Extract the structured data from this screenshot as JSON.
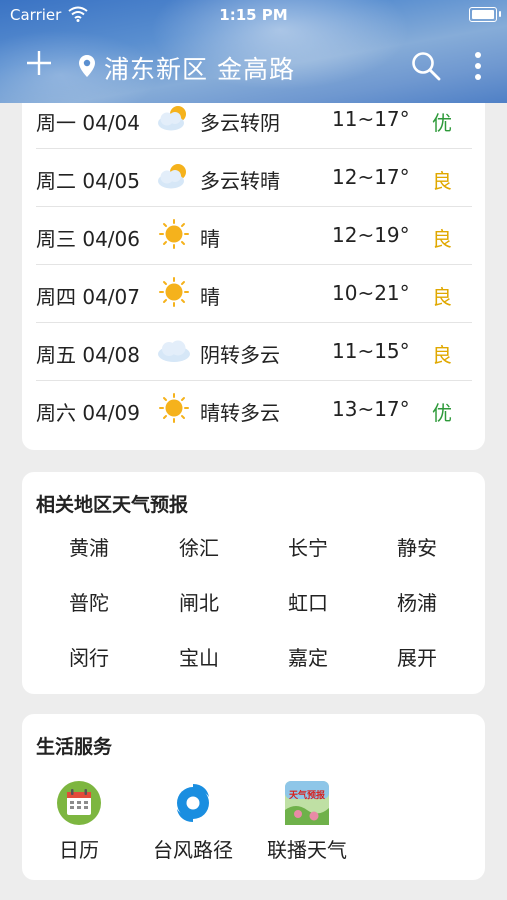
{
  "status": {
    "carrier": "Carrier",
    "time": "1:15 PM"
  },
  "header": {
    "location": "浦东新区 金高路"
  },
  "forecast": [
    {
      "date": "周一 04/04",
      "icon": "cloudy-sun-icon",
      "condition": "多云转阴",
      "temp": "11~17°",
      "aqi": "优",
      "aqi_color": "#2e9a3a"
    },
    {
      "date": "周二 04/05",
      "icon": "cloudy-sun-icon",
      "condition": "多云转晴",
      "temp": "12~17°",
      "aqi": "良",
      "aqi_color": "#e0a800"
    },
    {
      "date": "周三 04/06",
      "icon": "sun-icon",
      "condition": "晴",
      "temp": "12~19°",
      "aqi": "良",
      "aqi_color": "#e0a800"
    },
    {
      "date": "周四 04/07",
      "icon": "sun-icon",
      "condition": "晴",
      "temp": "10~21°",
      "aqi": "良",
      "aqi_color": "#e0a800"
    },
    {
      "date": "周五 04/08",
      "icon": "cloud-icon",
      "condition": "阴转多云",
      "temp": "11~15°",
      "aqi": "良",
      "aqi_color": "#e0a800"
    },
    {
      "date": "周六 04/09",
      "icon": "sun-icon",
      "condition": "晴转多云",
      "temp": "13~17°",
      "aqi": "优",
      "aqi_color": "#2e9a3a"
    }
  ],
  "region": {
    "title": "相关地区天气预报",
    "items": [
      "黄浦",
      "徐汇",
      "长宁",
      "静安",
      "普陀",
      "闸北",
      "虹口",
      "杨浦",
      "闵行",
      "宝山",
      "嘉定",
      "展开"
    ]
  },
  "services": {
    "title": "生活服务",
    "items": [
      {
        "label": "日历",
        "icon": "calendar-icon"
      },
      {
        "label": "台风路径",
        "icon": "typhoon-icon"
      },
      {
        "label": "联播天气",
        "icon": "weather-broadcast-icon",
        "icon_text": "天气预报"
      }
    ]
  }
}
